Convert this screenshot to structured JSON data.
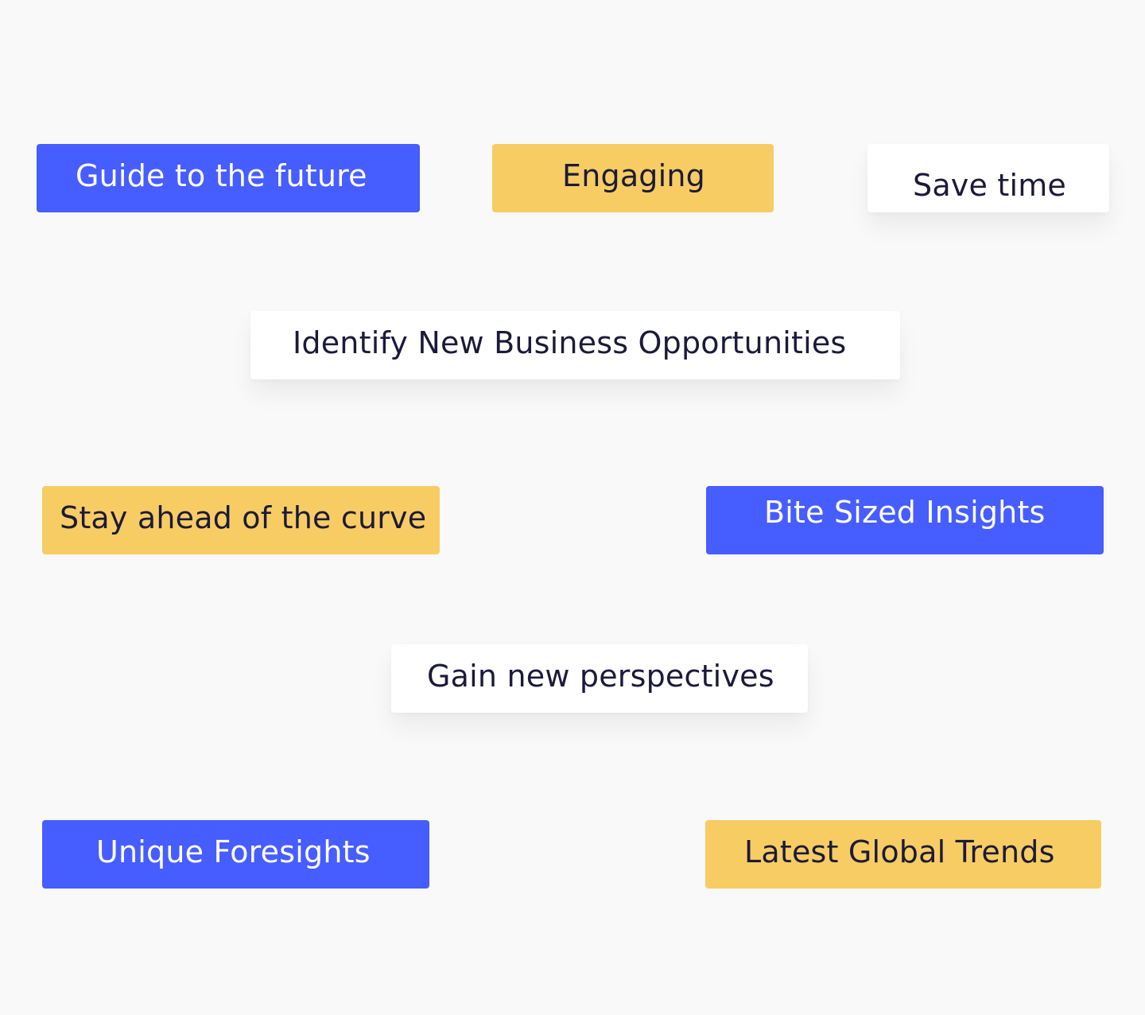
{
  "tags": [
    {
      "label": "Guide to the future",
      "style": "blue"
    },
    {
      "label": "Engaging",
      "style": "yellow"
    },
    {
      "label": "Save time",
      "style": "white"
    },
    {
      "label": "Identify New Business Opportunities",
      "style": "white"
    },
    {
      "label": "Stay ahead of the curve",
      "style": "yellow"
    },
    {
      "label": "Bite Sized Insights",
      "style": "blue"
    },
    {
      "label": "Gain new perspectives",
      "style": "white"
    },
    {
      "label": "Unique Foresights",
      "style": "blue"
    },
    {
      "label": "Latest Global Trends",
      "style": "yellow"
    }
  ],
  "colors": {
    "background": "#f9f9f9",
    "blue": "#465dff",
    "yellow": "#f7cd63",
    "white": "#ffffff",
    "dark_text": "#1c1a3a"
  }
}
